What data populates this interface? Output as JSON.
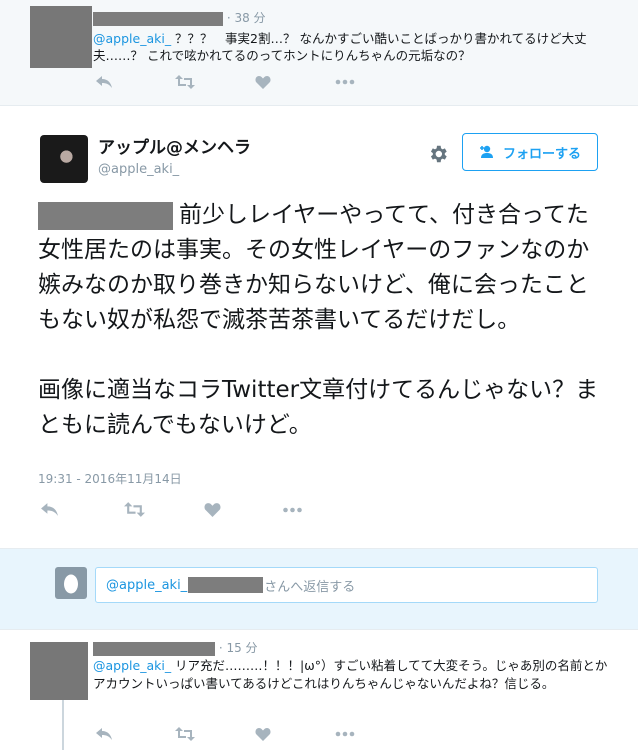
{
  "top_reply": {
    "time": "· 38 分",
    "mention": "@apple_aki_",
    "text": " ？？？　事実2割…？ なんかすごい酷いことばっかり書かれてるけど大丈夫……？ これで呟かれてるのってホントにりんちゃんの元垢なの？"
  },
  "main_tweet": {
    "name": "アップル@メンヘラ",
    "handle": "@apple_aki_",
    "follow_label": "フォローする",
    "text_line1": "前少しレイヤーやってて、付き合ってた女性居たのは事実。その女性レイヤーのファンなのか嫉みなのか取り巻きか知らないけど、俺に会ったこともない奴が私怨で滅茶苦茶書いてるだけだし。",
    "text_line2": "画像に適当なコラTwitter文章付けてるんじゃない？まともに読んでもないけど。",
    "timestamp": "19:31 - 2016年11月14日"
  },
  "reply_box": {
    "mention": "@apple_aki_",
    "suffix": "さんへ返信する"
  },
  "bottom_reply": {
    "time": "· 15 分",
    "mention": "@apple_aki_",
    "text": " リア充だ………！！！|ω°）すごい粘着してて大変そう。じゃあ別の名前とかアカウントいっぱい書いてあるけどこれはりんちゃんじゃないんだよね？信じる。"
  },
  "icons": {
    "reply": "reply-icon",
    "retweet": "retweet-icon",
    "like": "heart-icon",
    "more": "more-icon",
    "settings": "gear-icon",
    "follow": "follow-person-icon",
    "egg": "egg-avatar-icon"
  },
  "colors": {
    "accent": "#1da1f2",
    "link": "#1b95e0",
    "muted": "#8899a6",
    "reply_bg": "#e8f5fd"
  }
}
